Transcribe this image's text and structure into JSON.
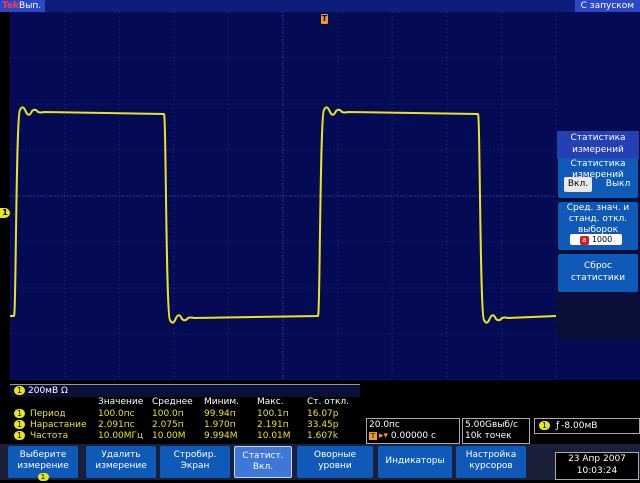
{
  "status": {
    "brand": "Tek",
    "run_state": "Вып.",
    "trigger_mode": "С запуском"
  },
  "markers": {
    "trigger_position": "T",
    "ch1_ground": "1"
  },
  "side_menu": {
    "title": "Статистика измерений",
    "stats_button": {
      "label": "Статистика измерений",
      "on": "Вкл.",
      "off": "Выкл"
    },
    "averaging": {
      "label": "Сред. знач. и станд. откл. выборок",
      "knob": "a",
      "value": "1000"
    },
    "reset": {
      "label": "Сброс статистики"
    }
  },
  "channel": {
    "number": "1",
    "scale": "200мВ Ω"
  },
  "measurements": {
    "headers": [
      "Значение",
      "Среднее",
      "Миним.",
      "Макс.",
      "Ст. откл."
    ],
    "rows": [
      {
        "ch": "1",
        "name": "Период",
        "value": "100.0пс",
        "mean": "100.0п",
        "min": "99.94п",
        "max": "100.1п",
        "std": "16.07p"
      },
      {
        "ch": "1",
        "name": "Нарастание",
        "value": "2.091пс",
        "mean": "2.075п",
        "min": "1.970п",
        "max": "2.191п",
        "std": "33.45p"
      },
      {
        "ch": "1",
        "name": "Частота",
        "value": "10.00МГц",
        "mean": "10.00M",
        "min": "9.994M",
        "max": "10.01M",
        "std": "1.607k"
      }
    ]
  },
  "horizontal": {
    "scale": "20.0пс",
    "trig_icon": "T",
    "position": "0.00000 с",
    "arrow": "▸▾"
  },
  "sampling": {
    "rate": "5.00Gвыб/с",
    "record": "10k точек"
  },
  "trigger": {
    "ch": "1",
    "slope": "ƒ",
    "level": "-8.00мВ"
  },
  "bottom_menu": {
    "items": [
      {
        "label": "Выберите измерение",
        "chip": "1"
      },
      {
        "label": "Удалить измерение"
      },
      {
        "label": "Стробир. Экран"
      },
      {
        "label": "Статист. Вкл."
      },
      {
        "label": "Оворные уровни"
      },
      {
        "label": "Индикаторы"
      },
      {
        "label": "Настройка курсоров"
      }
    ]
  },
  "datetime": {
    "date": "23 Апр 2007",
    "time": "10:03:24"
  },
  "colors": {
    "trace": "#e8e51a",
    "screen": "#050a55",
    "button": "#0f59b8",
    "accent": "#f29a1c"
  }
}
